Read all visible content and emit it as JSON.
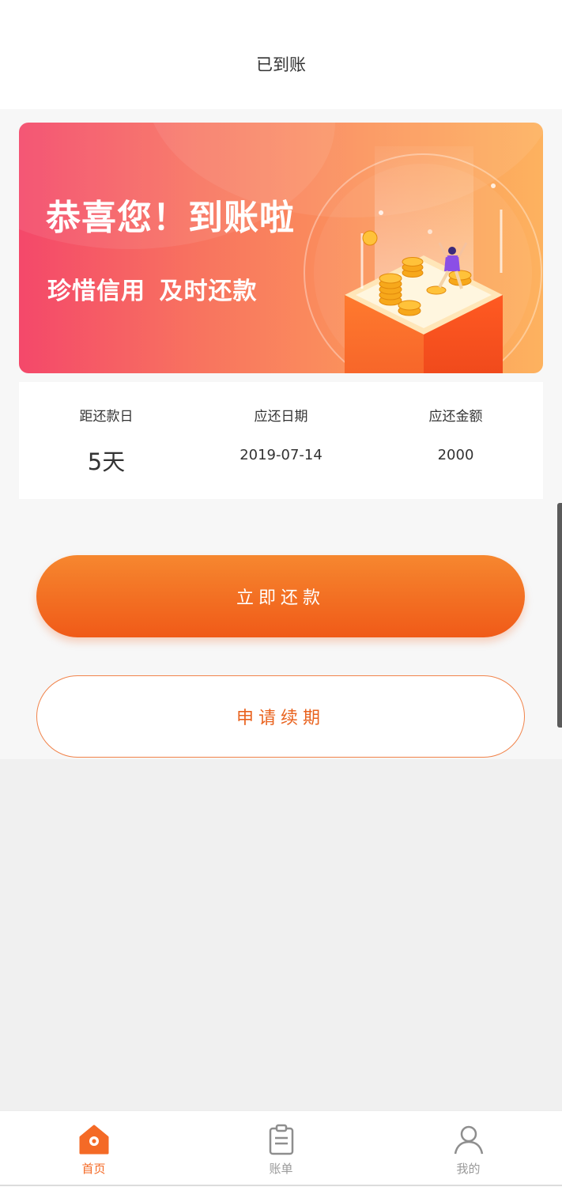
{
  "header": {
    "title": "已到账"
  },
  "banner": {
    "headline": "恭喜您！到账啦",
    "subline": "珍惜信用 及时还款",
    "illustration": "coins-podium-celebration"
  },
  "info": [
    {
      "label": "距还款日",
      "value": "5天"
    },
    {
      "label": "应还日期",
      "value": "2019-07-14"
    },
    {
      "label": "应还金额",
      "value": "2000"
    }
  ],
  "actions": {
    "repay_label": "立即还款",
    "extend_label": "申请续期"
  },
  "colors": {
    "accent": "#f46a26",
    "button_top": "#f6872f",
    "button_bottom": "#f05a18"
  },
  "tabs": [
    {
      "label": "首页",
      "icon": "home-icon",
      "active": true
    },
    {
      "label": "账单",
      "icon": "clipboard-icon",
      "active": false
    },
    {
      "label": "我的",
      "icon": "user-icon",
      "active": false
    }
  ]
}
